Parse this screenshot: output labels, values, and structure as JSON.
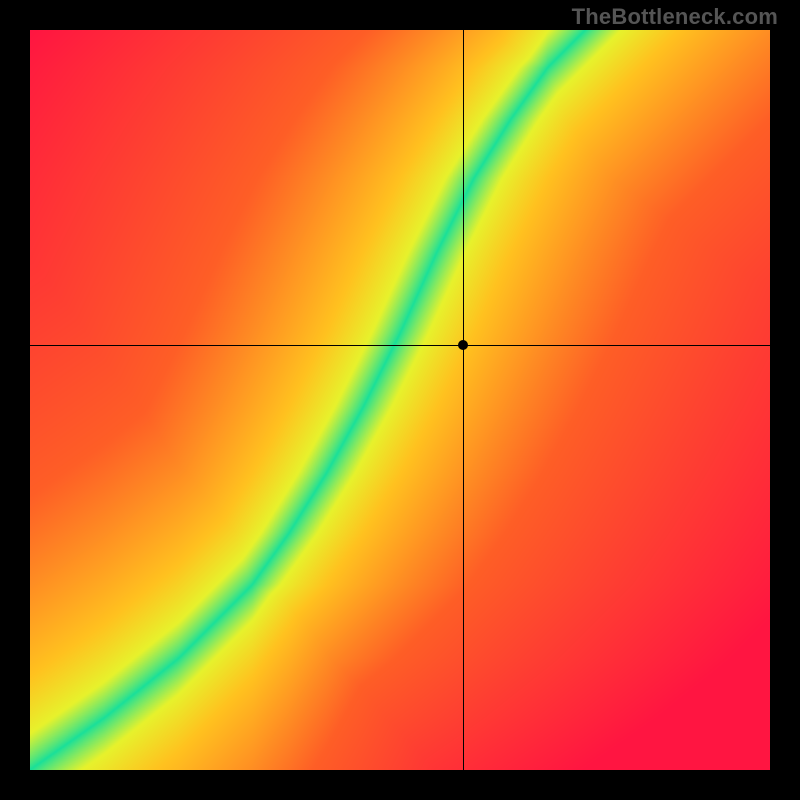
{
  "watermark": "TheBottleneck.com",
  "chart_data": {
    "type": "heatmap",
    "title": "",
    "xlabel": "",
    "ylabel": "",
    "xlim": [
      0,
      1
    ],
    "ylim": [
      0,
      1
    ],
    "crosshair": {
      "x": 0.585,
      "y": 0.575
    },
    "marker": {
      "x": 0.585,
      "y": 0.575
    },
    "optimal_curve": {
      "description": "Green ridge of the heatmap; approximate (x, y) pairs where the bottleneck ratio is balanced.",
      "points": [
        [
          0.0,
          0.0
        ],
        [
          0.1,
          0.07
        ],
        [
          0.2,
          0.15
        ],
        [
          0.3,
          0.25
        ],
        [
          0.35,
          0.32
        ],
        [
          0.4,
          0.4
        ],
        [
          0.45,
          0.49
        ],
        [
          0.5,
          0.59
        ],
        [
          0.55,
          0.7
        ],
        [
          0.6,
          0.8
        ],
        [
          0.65,
          0.88
        ],
        [
          0.7,
          0.95
        ],
        [
          0.75,
          1.0
        ]
      ]
    },
    "color_scale": {
      "stops_distance_fraction": [
        0.0,
        0.08,
        0.18,
        0.45,
        1.0
      ],
      "colors": [
        "#17E09B",
        "#E7F22C",
        "#FFC21F",
        "#FE5E26",
        "#FF1541"
      ],
      "meaning": "distance from optimal curve, 0 = green (balanced), 1 = red (severe bottleneck)"
    }
  }
}
